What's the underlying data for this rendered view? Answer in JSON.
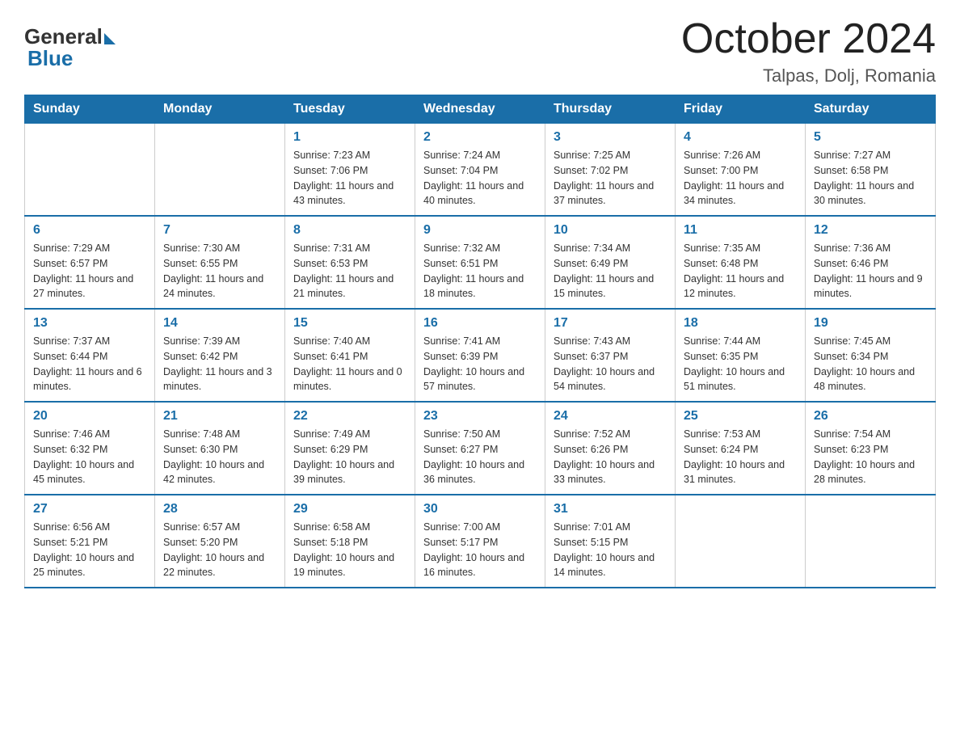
{
  "logo": {
    "general_text": "General",
    "blue_text": "Blue"
  },
  "title": "October 2024",
  "location": "Talpas, Dolj, Romania",
  "weekdays": [
    "Sunday",
    "Monday",
    "Tuesday",
    "Wednesday",
    "Thursday",
    "Friday",
    "Saturday"
  ],
  "weeks": [
    [
      {
        "day": "",
        "info": ""
      },
      {
        "day": "",
        "info": ""
      },
      {
        "day": "1",
        "info": "Sunrise: 7:23 AM\nSunset: 7:06 PM\nDaylight: 11 hours and 43 minutes."
      },
      {
        "day": "2",
        "info": "Sunrise: 7:24 AM\nSunset: 7:04 PM\nDaylight: 11 hours and 40 minutes."
      },
      {
        "day": "3",
        "info": "Sunrise: 7:25 AM\nSunset: 7:02 PM\nDaylight: 11 hours and 37 minutes."
      },
      {
        "day": "4",
        "info": "Sunrise: 7:26 AM\nSunset: 7:00 PM\nDaylight: 11 hours and 34 minutes."
      },
      {
        "day": "5",
        "info": "Sunrise: 7:27 AM\nSunset: 6:58 PM\nDaylight: 11 hours and 30 minutes."
      }
    ],
    [
      {
        "day": "6",
        "info": "Sunrise: 7:29 AM\nSunset: 6:57 PM\nDaylight: 11 hours and 27 minutes."
      },
      {
        "day": "7",
        "info": "Sunrise: 7:30 AM\nSunset: 6:55 PM\nDaylight: 11 hours and 24 minutes."
      },
      {
        "day": "8",
        "info": "Sunrise: 7:31 AM\nSunset: 6:53 PM\nDaylight: 11 hours and 21 minutes."
      },
      {
        "day": "9",
        "info": "Sunrise: 7:32 AM\nSunset: 6:51 PM\nDaylight: 11 hours and 18 minutes."
      },
      {
        "day": "10",
        "info": "Sunrise: 7:34 AM\nSunset: 6:49 PM\nDaylight: 11 hours and 15 minutes."
      },
      {
        "day": "11",
        "info": "Sunrise: 7:35 AM\nSunset: 6:48 PM\nDaylight: 11 hours and 12 minutes."
      },
      {
        "day": "12",
        "info": "Sunrise: 7:36 AM\nSunset: 6:46 PM\nDaylight: 11 hours and 9 minutes."
      }
    ],
    [
      {
        "day": "13",
        "info": "Sunrise: 7:37 AM\nSunset: 6:44 PM\nDaylight: 11 hours and 6 minutes."
      },
      {
        "day": "14",
        "info": "Sunrise: 7:39 AM\nSunset: 6:42 PM\nDaylight: 11 hours and 3 minutes."
      },
      {
        "day": "15",
        "info": "Sunrise: 7:40 AM\nSunset: 6:41 PM\nDaylight: 11 hours and 0 minutes."
      },
      {
        "day": "16",
        "info": "Sunrise: 7:41 AM\nSunset: 6:39 PM\nDaylight: 10 hours and 57 minutes."
      },
      {
        "day": "17",
        "info": "Sunrise: 7:43 AM\nSunset: 6:37 PM\nDaylight: 10 hours and 54 minutes."
      },
      {
        "day": "18",
        "info": "Sunrise: 7:44 AM\nSunset: 6:35 PM\nDaylight: 10 hours and 51 minutes."
      },
      {
        "day": "19",
        "info": "Sunrise: 7:45 AM\nSunset: 6:34 PM\nDaylight: 10 hours and 48 minutes."
      }
    ],
    [
      {
        "day": "20",
        "info": "Sunrise: 7:46 AM\nSunset: 6:32 PM\nDaylight: 10 hours and 45 minutes."
      },
      {
        "day": "21",
        "info": "Sunrise: 7:48 AM\nSunset: 6:30 PM\nDaylight: 10 hours and 42 minutes."
      },
      {
        "day": "22",
        "info": "Sunrise: 7:49 AM\nSunset: 6:29 PM\nDaylight: 10 hours and 39 minutes."
      },
      {
        "day": "23",
        "info": "Sunrise: 7:50 AM\nSunset: 6:27 PM\nDaylight: 10 hours and 36 minutes."
      },
      {
        "day": "24",
        "info": "Sunrise: 7:52 AM\nSunset: 6:26 PM\nDaylight: 10 hours and 33 minutes."
      },
      {
        "day": "25",
        "info": "Sunrise: 7:53 AM\nSunset: 6:24 PM\nDaylight: 10 hours and 31 minutes."
      },
      {
        "day": "26",
        "info": "Sunrise: 7:54 AM\nSunset: 6:23 PM\nDaylight: 10 hours and 28 minutes."
      }
    ],
    [
      {
        "day": "27",
        "info": "Sunrise: 6:56 AM\nSunset: 5:21 PM\nDaylight: 10 hours and 25 minutes."
      },
      {
        "day": "28",
        "info": "Sunrise: 6:57 AM\nSunset: 5:20 PM\nDaylight: 10 hours and 22 minutes."
      },
      {
        "day": "29",
        "info": "Sunrise: 6:58 AM\nSunset: 5:18 PM\nDaylight: 10 hours and 19 minutes."
      },
      {
        "day": "30",
        "info": "Sunrise: 7:00 AM\nSunset: 5:17 PM\nDaylight: 10 hours and 16 minutes."
      },
      {
        "day": "31",
        "info": "Sunrise: 7:01 AM\nSunset: 5:15 PM\nDaylight: 10 hours and 14 minutes."
      },
      {
        "day": "",
        "info": ""
      },
      {
        "day": "",
        "info": ""
      }
    ]
  ]
}
